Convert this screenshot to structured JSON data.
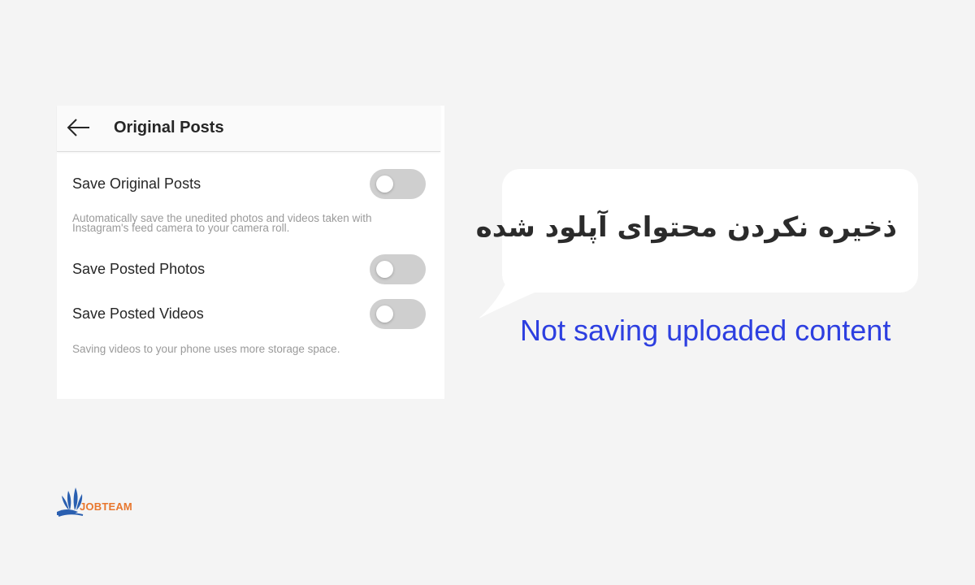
{
  "settings_screen": {
    "header": {
      "title": "Original Posts",
      "back_icon": "arrow-left-icon"
    },
    "items": [
      {
        "label": "Save Original Posts",
        "enabled": false
      },
      {
        "label": "Save Posted Photos",
        "enabled": false
      },
      {
        "label": "Save Posted Videos",
        "enabled": false
      }
    ],
    "descriptions": {
      "original_line1": "Automatically save the unedited photos and videos taken with",
      "original_line2": "Instagram's feed camera to your camera roll.",
      "videos": "Saving videos to your phone uses more storage space."
    }
  },
  "callout": {
    "persian_text": "ذخیره نکردن محتوای آپلود شده",
    "english_caption": "Not saving uploaded content"
  },
  "logo": {
    "text": "JOBTEAM"
  },
  "colors": {
    "background": "#f4f4f4",
    "caption_blue": "#2d3fe0",
    "toggle_off": "#cfcfcf",
    "logo_orange": "#e8772e",
    "logo_blue": "#2a5fb0"
  }
}
